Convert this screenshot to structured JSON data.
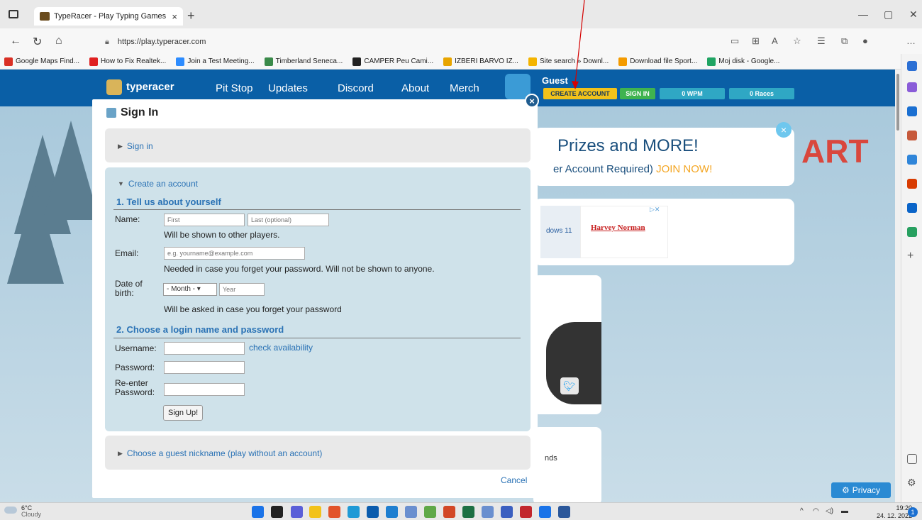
{
  "browser": {
    "tab_title": "TypeRacer - Play Typing Games",
    "url": "https://play.typeracer.com",
    "bookmarks": [
      {
        "label": "Google Maps Find...",
        "color": "#d93025"
      },
      {
        "label": "How to Fix Realtek...",
        "color": "#e02020"
      },
      {
        "label": "Join a Test Meeting...",
        "color": "#2d8cff"
      },
      {
        "label": "Timberland Seneca...",
        "color": "#3a8a4a"
      },
      {
        "label": "CAMPER Peu Cami...",
        "color": "#222222"
      },
      {
        "label": "IZBERI BARVO IZ...",
        "color": "#e8a500"
      },
      {
        "label": "Site search » Downl...",
        "color": "#f4b400"
      },
      {
        "label": "Download file Sport...",
        "color": "#f49b00"
      },
      {
        "label": "Moj disk - Google...",
        "color": "#1fa463"
      }
    ]
  },
  "site": {
    "brand": "typeracer",
    "nav": [
      "Pit Stop",
      "Updates",
      "Discord",
      "About",
      "Merch"
    ],
    "guest_name": "Guest",
    "create_account": "CREATE ACCOUNT",
    "sign_in": "SIGN IN",
    "wpm": "0 WPM",
    "races": "0 Races"
  },
  "promo": {
    "headline": "Prizes and MORE!",
    "sub": "er Account Required)",
    "join": "JOIN NOW!",
    "art_text": "ART"
  },
  "ad": {
    "left_text": "dows 11",
    "brand": "Harvey Norman"
  },
  "card4_text": "nds",
  "privacy": "Privacy",
  "modal": {
    "title": "Sign In",
    "sign_in_toggle": "Sign in",
    "create_toggle": "Create an account",
    "section1": "1. Tell us about yourself",
    "name_label": "Name:",
    "first_placeholder": "First",
    "last_placeholder": "Last (optional)",
    "name_help": "Will be shown to other players.",
    "email_label": "Email:",
    "email_placeholder": "e.g. yourname@example.com",
    "email_help": "Needed in case you forget your password. Will not be shown to anyone.",
    "dob_label_1": "Date of",
    "dob_label_2": "birth:",
    "month_value": "- Month -",
    "year_placeholder": "Year",
    "dob_help": "Will be asked in case you forget your password",
    "section2": "2. Choose a login name and password",
    "username_label": "Username:",
    "check_availability": "check availability",
    "password_label": "Password:",
    "reenter_label_1": "Re-enter",
    "reenter_label_2": "Password:",
    "signup_button": "Sign Up!",
    "guest_toggle": "Choose a guest nickname (play without an account)",
    "cancel": "Cancel"
  },
  "taskbar": {
    "temp": "6°C",
    "weather": "Cloudy",
    "time": "19:20",
    "date": "24. 12. 2022",
    "notifications": "1"
  }
}
